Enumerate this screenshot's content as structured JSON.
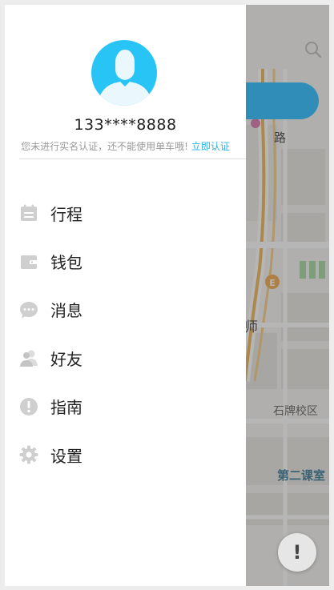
{
  "user": {
    "phone": "133****8888",
    "verify_notice": "您未进行实名认证，还不能使用单车哦!",
    "verify_link": "立即认证"
  },
  "menu": [
    {
      "label": "行程",
      "icon": "calendar-icon"
    },
    {
      "label": "钱包",
      "icon": "wallet-icon"
    },
    {
      "label": "消息",
      "icon": "message-icon"
    },
    {
      "label": "好友",
      "icon": "friends-icon"
    },
    {
      "label": "指南",
      "icon": "guide-icon"
    },
    {
      "label": "设置",
      "icon": "gear-icon"
    }
  ],
  "map": {
    "labels": {
      "road": "路",
      "teacher": "师",
      "school": "石牌校区",
      "classroom": "第二课室"
    },
    "marker": "E",
    "floating_button_icon": "exclamation-icon"
  },
  "colors": {
    "accent": "#2ab3e8",
    "avatar_bg": "#29c4f6",
    "icon_gray": "#cfcfcf",
    "text": "#222222",
    "muted": "#9a9a9a"
  }
}
